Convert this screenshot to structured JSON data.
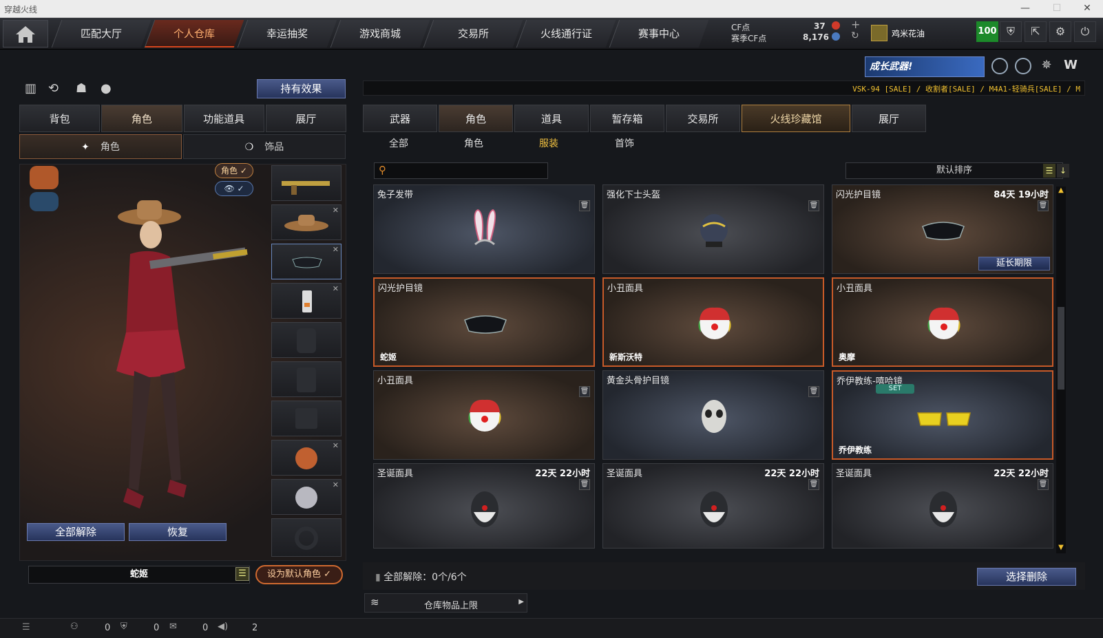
{
  "window": {
    "title": "穿越火线"
  },
  "nav": {
    "tabs": [
      "匹配大厅",
      "个人仓库",
      "幸运抽奖",
      "游戏商城",
      "交易所",
      "火线通行证",
      "赛事中心"
    ],
    "active": 1
  },
  "currency": {
    "cf_label": "CF点",
    "cf_value": "37",
    "season_label": "赛季CF点",
    "season_value": "8,176"
  },
  "user": {
    "name": "鸡米花油",
    "level": "100"
  },
  "banner": {
    "promo": "成长武器!",
    "ticker": "VSK-94  [SALE] / 收割者[SALE] / M4A1-轻骑兵[SALE] / M"
  },
  "left": {
    "effect_btn": "持有效果",
    "tabs": [
      "背包",
      "角色",
      "功能道具",
      "展厅"
    ],
    "subtabs": [
      "角色",
      "饰品"
    ],
    "role_toggle": "角色",
    "unequip_all": "全部解除",
    "restore": "恢复",
    "character_name": "蛇姬",
    "set_default": "设为默认角色"
  },
  "right": {
    "tabs": [
      "武器",
      "角色",
      "道具",
      "暂存箱",
      "交易所",
      "火线珍藏馆",
      "展厅"
    ],
    "subtabs": [
      "全部",
      "角色",
      "服装",
      "首饰"
    ],
    "sort": "默认排序",
    "cards": [
      {
        "name": "兔子发带",
        "time": "",
        "owner": "",
        "theme": "blue",
        "icon": "bunny-ears-icon"
      },
      {
        "name": "强化下士头盔",
        "time": "",
        "owner": "",
        "theme": "grey",
        "icon": "helmet-icon"
      },
      {
        "name": "闪光护目镜",
        "time": "84天 19小时",
        "owner": "",
        "theme": "brown",
        "icon": "goggles-icon",
        "extend": "延长期限"
      },
      {
        "name": "闪光护目镜",
        "time": "",
        "owner": "蛇姬",
        "theme": "brown",
        "icon": "goggles-icon"
      },
      {
        "name": "小丑面具",
        "time": "",
        "owner": "新斯沃特",
        "theme": "brown",
        "icon": "clown-mask-icon"
      },
      {
        "name": "小丑面具",
        "time": "",
        "owner": "奥摩",
        "theme": "brown",
        "icon": "clown-mask-icon"
      },
      {
        "name": "小丑面具",
        "time": "",
        "owner": "",
        "theme": "brown",
        "icon": "clown-mask-icon"
      },
      {
        "name": "黄金头骨护目镜",
        "time": "",
        "owner": "",
        "theme": "blue",
        "icon": "skull-mask-icon"
      },
      {
        "name": "乔伊教练-嘻哈镜",
        "time": "",
        "owner": "乔伊教练",
        "theme": "blue",
        "icon": "shutter-shades-icon",
        "set": "SET"
      },
      {
        "name": "圣诞面具",
        "time": "22天 22小时",
        "owner": "",
        "theme": "grey",
        "icon": "santa-mask-icon"
      },
      {
        "name": "圣诞面具",
        "time": "22天 22小时",
        "owner": "",
        "theme": "grey",
        "icon": "santa-mask-icon"
      },
      {
        "name": "圣诞面具",
        "time": "22天 22小时",
        "owner": "",
        "theme": "grey",
        "icon": "santa-mask-icon"
      }
    ],
    "unequip_status": "全部解除：0个/6个",
    "select_delete": "选择删除",
    "storage_limit": "仓库物品上限"
  },
  "bottom": {
    "counts": [
      "0",
      "0",
      "0",
      "2"
    ]
  }
}
